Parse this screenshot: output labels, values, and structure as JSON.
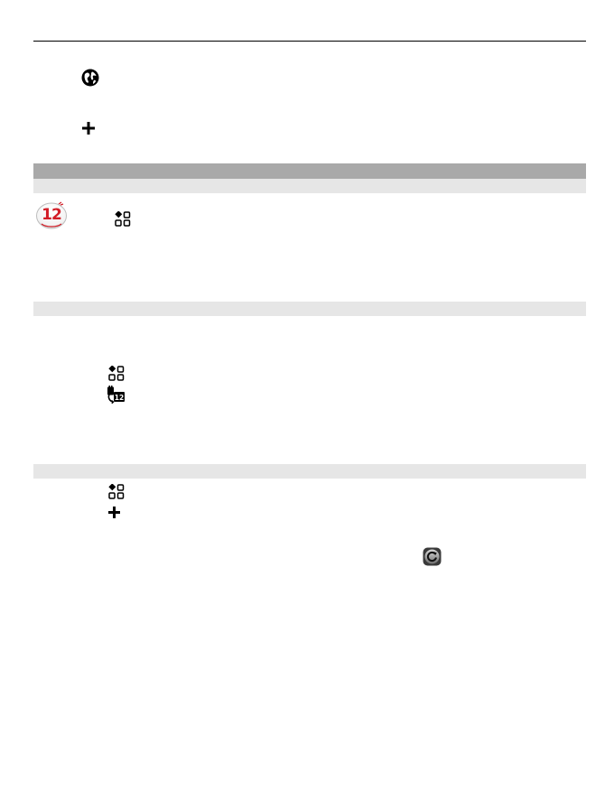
{
  "page": {
    "background_color": "#ffffff",
    "rule_color": "#000000",
    "section_bar_dark_color": "#a9a9a9",
    "section_bar_light_color": "#e6e6e6"
  },
  "calendar_icon": {
    "day_number": "12",
    "accent_color": "#d21d27"
  },
  "icons": [
    "globe-icon",
    "plus-icon",
    "calendar-icon",
    "menu-apps-icon",
    "calendar-sync-icon",
    "refresh-icon"
  ]
}
